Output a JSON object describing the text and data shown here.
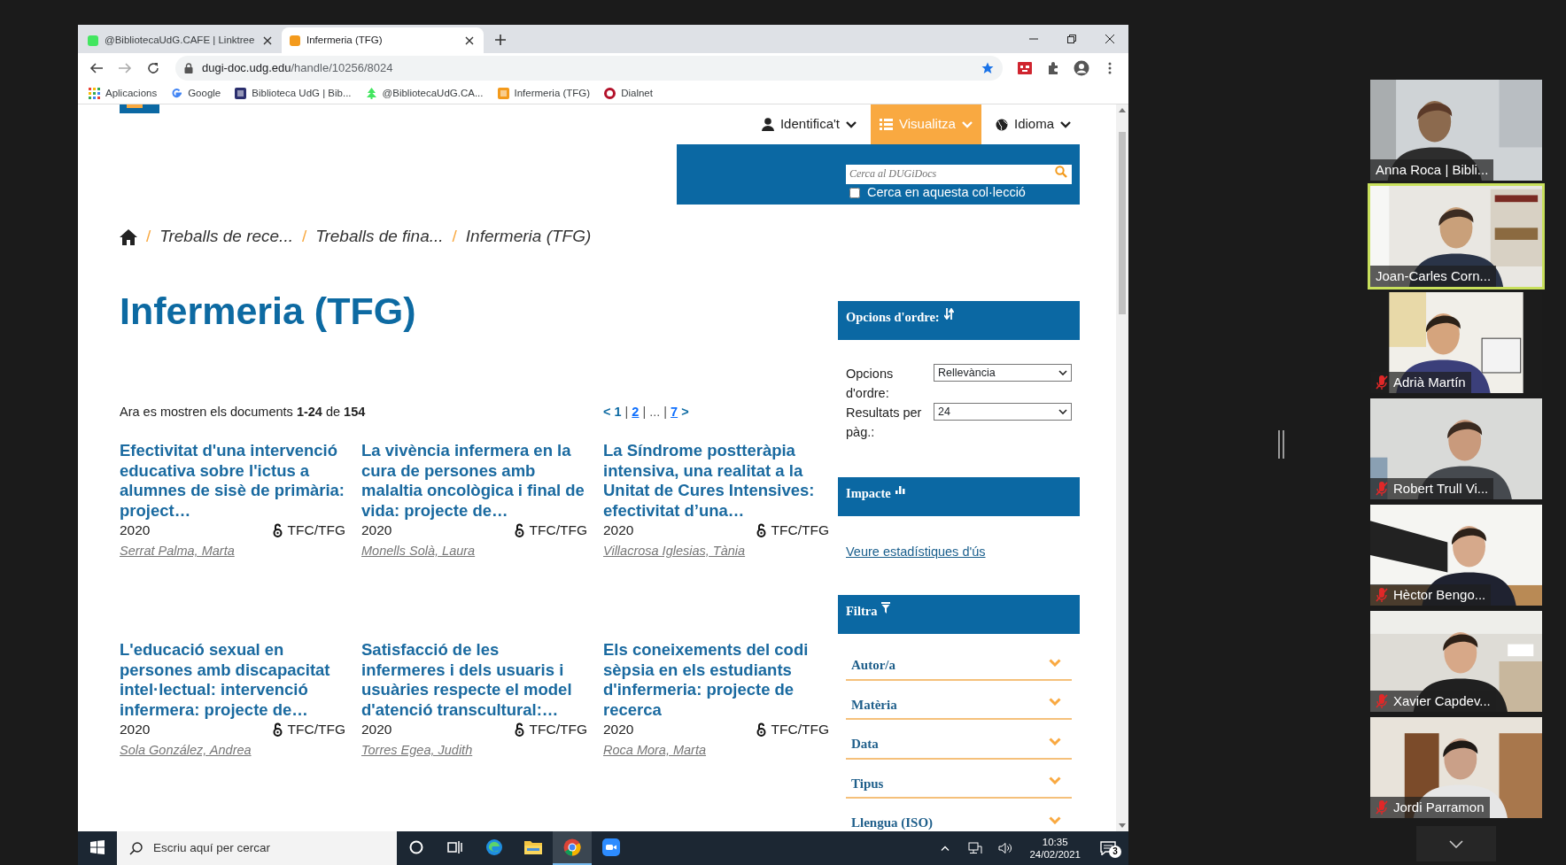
{
  "browser": {
    "tabs": [
      {
        "title": "@BibliotecaUdG.CAFE | Linktree",
        "color": "#43e660",
        "selected": false
      },
      {
        "title": "Infermeria (TFG)",
        "color": "#f39a1c",
        "selected": true
      }
    ],
    "url_host": "dugi-doc.udg.edu",
    "url_path": "/handle/10256/8024",
    "bookmarked": true,
    "bookmarks": [
      {
        "label": "Aplicacions",
        "kind": "apps"
      },
      {
        "label": "Google",
        "kind": "google"
      },
      {
        "label": "Biblioteca UdG | Bib...",
        "kind": "square",
        "color": "#2b2f6e"
      },
      {
        "label": "@BibliotecaUdG.CA...",
        "kind": "tree",
        "color": "#43e660"
      },
      {
        "label": "Infermeria (TFG)",
        "kind": "square",
        "color": "#f39a1c"
      },
      {
        "label": "Dialnet",
        "kind": "ring",
        "color": "#b3112a"
      }
    ]
  },
  "site": {
    "nav": [
      {
        "label": "Identifica't",
        "kind": "user",
        "selected": false
      },
      {
        "label": "Visualitza",
        "kind": "list",
        "selected": true
      },
      {
        "label": "Idioma",
        "kind": "globe",
        "selected": false
      }
    ],
    "search": {
      "placeholder": "Cerca al DUGiDocs",
      "scope_label": "Cerca en aquesta col·lecció",
      "scope_checked": false
    },
    "breadcrumb": [
      {
        "label": "Treballs de rece...",
        "separator": "/"
      },
      {
        "label": "Treballs de fina...",
        "separator": "/"
      },
      {
        "label": "Infermeria (TFG)",
        "separator": "/"
      }
    ],
    "title": "Infermeria (TFG)",
    "results": "Ara es mostren els documents **1-24** de **154**",
    "pagination": [
      {
        "label": "<",
        "kind": "arrow"
      },
      {
        "label": "1",
        "kind": "current"
      },
      {
        "label": "|",
        "kind": "sep"
      },
      {
        "label": "2",
        "kind": "link"
      },
      {
        "label": "|",
        "kind": "sep"
      },
      {
        "label": "...",
        "kind": "gap"
      },
      {
        "label": "|",
        "kind": "sep"
      },
      {
        "label": "7",
        "kind": "link"
      },
      {
        "label": ">",
        "kind": "arrow"
      }
    ],
    "items": [
      {
        "title": "Efectivitat d'una intervenció educativa sobre l'ictus a alumnes de sisè de primària: project…",
        "year": "2020",
        "type": "TFC/TFG",
        "author": "Serrat Palma, Marta"
      },
      {
        "title": "La vivència infermera en la cura de persones amb malaltia oncològica i final de vida: projecte de…",
        "year": "2020",
        "type": "TFC/TFG",
        "author": "Monells Solà, Laura"
      },
      {
        "title": "La Síndrome postteràpia intensiva, una realitat a la Unitat de Cures Intensives: efectivitat d’una…",
        "year": "2020",
        "type": "TFC/TFG",
        "author": "Villacrosa Iglesias, Tània"
      },
      {
        "title": "L'educació sexual en persones amb discapacitat intel·lectual: intervenció infermera: projecte de…",
        "year": "2020",
        "type": "TFC/TFG",
        "author": "Sola González, Andrea"
      },
      {
        "title": "Satisfacció de les infermeres i dels usuaris i usuàries respecte el model d'atenció transcultural:…",
        "year": "2020",
        "type": "TFC/TFG",
        "author": "Torres Egea, Judith"
      },
      {
        "title": "Els coneixements del codi sèpsia en els estudiants d'infermeria: projecte de recerca",
        "year": "2020",
        "type": "TFC/TFG",
        "author": "Roca Mora, Marta"
      }
    ],
    "sort": {
      "title": "Opcions d'ordre:",
      "fields": [
        {
          "label": "Opcions d'ordre:",
          "value": "Rellevància"
        },
        {
          "label": "Resultats per pàg.:",
          "value": "24"
        }
      ]
    },
    "impact": {
      "title": "Impacte",
      "link": "Veure estadístiques d'ús"
    },
    "filter": {
      "title": "Filtra",
      "facets": [
        "Autor/a",
        "Matèria",
        "Data",
        "Tipus",
        "Llengua (ISO)"
      ]
    }
  },
  "taskbar": {
    "search_placeholder": "Escriu aquí per cercar",
    "apps": [
      {
        "kind": "cortana",
        "active": false
      },
      {
        "kind": "taskview",
        "active": false
      },
      {
        "kind": "edge",
        "active": false
      },
      {
        "kind": "explorer",
        "active": false
      },
      {
        "kind": "chrome",
        "active": true
      },
      {
        "kind": "zoom",
        "active": false
      }
    ],
    "time": "10:35",
    "date": "24/02/2021",
    "notifications": "3"
  },
  "meeting": {
    "participants": [
      {
        "name": "Anna Roca | Bibli...",
        "muted": false,
        "speaking": false
      },
      {
        "name": "Joan-Carles Corn...",
        "muted": false,
        "speaking": true
      },
      {
        "name": "Adrià Martín",
        "muted": true,
        "speaking": false
      },
      {
        "name": "Robert Trull Vi...",
        "muted": true,
        "speaking": false
      },
      {
        "name": "Hèctor Bengo...",
        "muted": true,
        "speaking": false
      },
      {
        "name": "Xavier Capdev...",
        "muted": true,
        "speaking": false
      },
      {
        "name": "Jordi Parramon",
        "muted": true,
        "speaking": false
      }
    ]
  }
}
